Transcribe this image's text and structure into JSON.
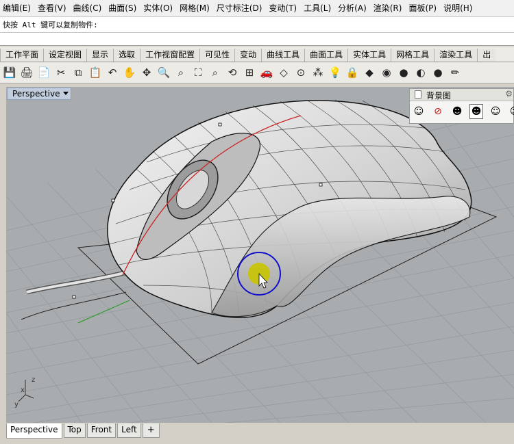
{
  "menu": [
    "编辑(E)",
    "查看(V)",
    "曲线(C)",
    "曲面(S)",
    "实体(O)",
    "网格(M)",
    "尺寸标注(D)",
    "变动(T)",
    "工具(L)",
    "分析(A)",
    "渲染(R)",
    "面板(P)",
    "说明(H)"
  ],
  "command": {
    "history": "快按 Alt 键可以复制物件:"
  },
  "toolbar_tabs": [
    "工作平面",
    "设定视图",
    "显示",
    "选取",
    "工作视窗配置",
    "可见性",
    "变动",
    "曲线工具",
    "曲面工具",
    "实体工具",
    "网格工具",
    "渲染工具",
    "出"
  ],
  "toolbar_icons": [
    {
      "name": "save-icon",
      "glyph": "💾"
    },
    {
      "name": "print-icon",
      "glyph": "🖨"
    },
    {
      "name": "copy-doc-icon",
      "glyph": "📄"
    },
    {
      "name": "cut-icon",
      "glyph": "✂"
    },
    {
      "name": "copy-icon",
      "glyph": "⧉"
    },
    {
      "name": "paste-icon",
      "glyph": "📋"
    },
    {
      "name": "undo-icon",
      "glyph": "↶"
    },
    {
      "name": "pan-hand-icon",
      "glyph": "✋"
    },
    {
      "name": "rotate-view-icon",
      "glyph": "✥"
    },
    {
      "name": "zoom-icon",
      "glyph": "🔍"
    },
    {
      "name": "zoom-window-icon",
      "glyph": "⌕"
    },
    {
      "name": "zoom-extents-icon",
      "glyph": "⛶"
    },
    {
      "name": "zoom-selected-icon",
      "glyph": "⌕"
    },
    {
      "name": "undo-view-icon",
      "glyph": "⟲"
    },
    {
      "name": "four-viewports-icon",
      "glyph": "⊞"
    },
    {
      "name": "car-icon",
      "glyph": "🚗"
    },
    {
      "name": "named-cplane-icon",
      "glyph": "◇"
    },
    {
      "name": "cplane-icon",
      "glyph": "⊙"
    },
    {
      "name": "osnap-icon",
      "glyph": "⁂"
    },
    {
      "name": "light-bulb-icon",
      "glyph": "💡"
    },
    {
      "name": "lock-icon",
      "glyph": "🔒"
    },
    {
      "name": "layer-icon",
      "glyph": "◆"
    },
    {
      "name": "color-wheel-icon",
      "glyph": "◉"
    },
    {
      "name": "render-sphere-icon",
      "glyph": "●"
    },
    {
      "name": "shade-sphere-icon",
      "glyph": "◐"
    },
    {
      "name": "blue-sphere-icon",
      "glyph": "●"
    },
    {
      "name": "pencil-icon",
      "glyph": "✏"
    }
  ],
  "viewport": {
    "title": "Perspective"
  },
  "background_panel": {
    "title": "背景图",
    "icons": [
      "place-bg-icon",
      "remove-bg-icon",
      "show-bg-icon",
      "hide-bg-icon",
      "align-bg-icon",
      "scale-bg-icon"
    ]
  },
  "axis_labels": {
    "z": "z",
    "x": "x",
    "y": "y"
  },
  "bottom_tabs": [
    "Perspective",
    "Top",
    "Front",
    "Left"
  ],
  "add_tab_label": "+"
}
